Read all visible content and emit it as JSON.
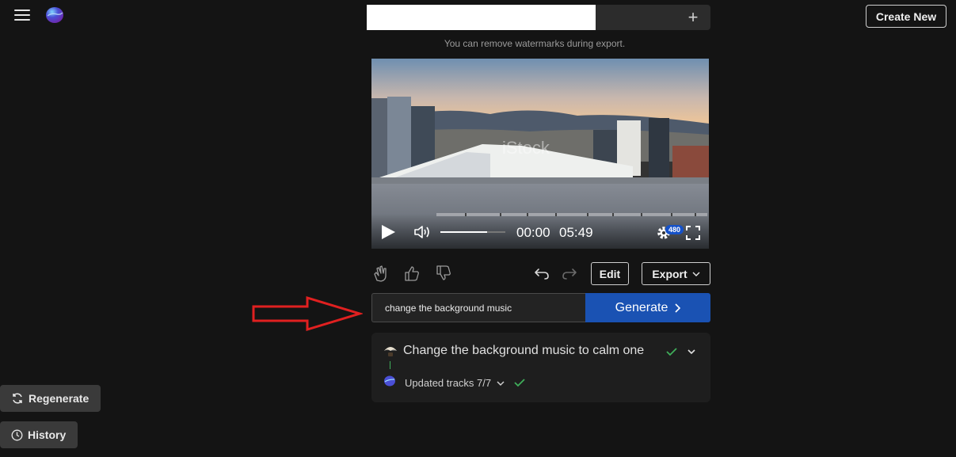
{
  "header": {
    "menu_icon": "hamburger-icon",
    "logo_icon": "app-logo",
    "create_new_label": "Create New",
    "title_value": "",
    "add_icon": "plus-icon",
    "watermark_note": "You can remove watermarks during export."
  },
  "player": {
    "current_time": "00:00",
    "duration": "05:49",
    "quality_badge": "480",
    "volume_level": 0.72,
    "icons": [
      "play-icon",
      "volume-icon",
      "gear-icon",
      "fullscreen-icon"
    ]
  },
  "feedback": {
    "icons": [
      "clap-icon",
      "thumbs-up-icon",
      "thumbs-down-icon",
      "undo-icon",
      "redo-icon"
    ]
  },
  "actions": {
    "edit_label": "Edit",
    "export_label": "Export"
  },
  "prompt": {
    "value": "change the background music",
    "generate_label": "Generate"
  },
  "task": {
    "title": "Change the background music to calm one",
    "subtitle": "Updated tracks 7/7"
  },
  "sidebar": {
    "regenerate_label": "Regenerate",
    "history_label": "History"
  },
  "colors": {
    "background": "#141414",
    "accent": "#1a52b3",
    "success": "#3fae5a",
    "annotation_arrow": "#e02020"
  }
}
